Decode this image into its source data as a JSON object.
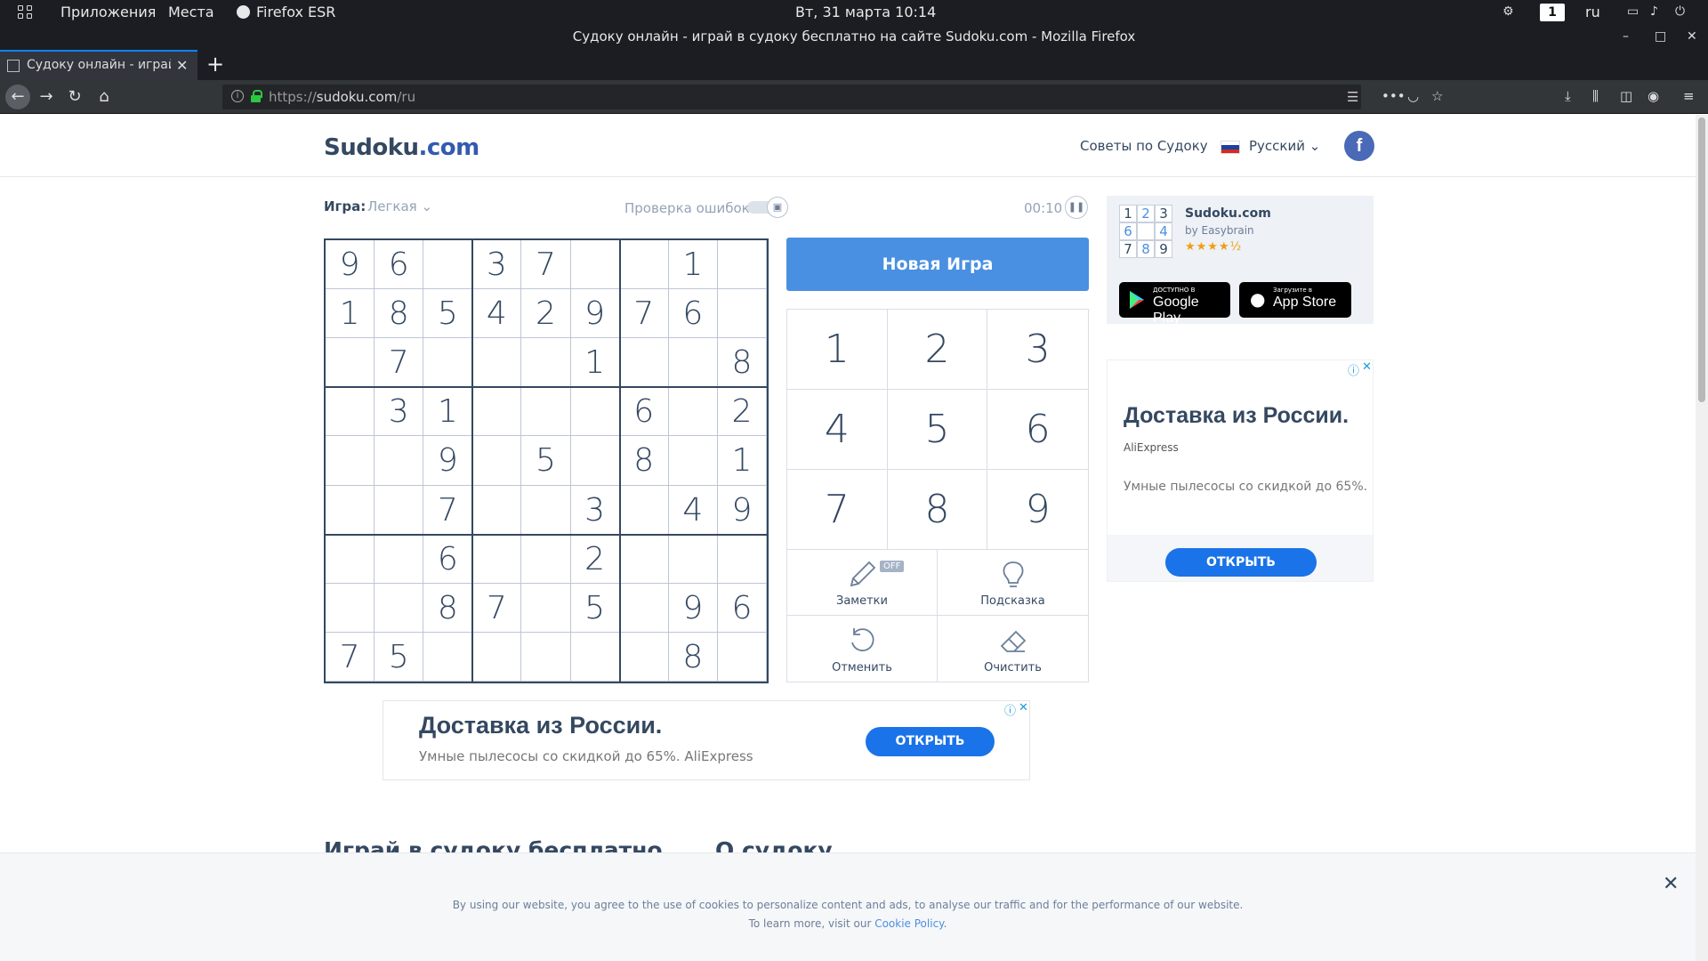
{
  "os": {
    "apps": "Приложения",
    "places": "Места",
    "browser_name": "Firefox ESR",
    "clock": "Вт, 31 марта  10:14",
    "workspace": "1",
    "lang": "ru"
  },
  "browser": {
    "window_title": "Судоку онлайн - играй в судоку бесплатно на сайте Sudoku.com - Mozilla Firefox",
    "tab_title": "Судоку онлайн - играй в судоку бесплатно",
    "url_scheme": "https://",
    "url_host": "sudoku.com",
    "url_path": "/ru"
  },
  "header": {
    "logo_main": "Sudoku",
    "logo_dot": ".com",
    "tips": "Советы по Судоку",
    "language": "Русский",
    "facebook": "f"
  },
  "game": {
    "label": "Игра:",
    "difficulty": "Легкая",
    "error_check": "Проверка ошибок",
    "timer": "00:10",
    "new_game": "Новая Игра",
    "grid": [
      [
        "9",
        "6",
        "",
        "3",
        "7",
        "",
        "",
        "1",
        ""
      ],
      [
        "1",
        "8",
        "5",
        "4",
        "2",
        "9",
        "7",
        "6",
        ""
      ],
      [
        "",
        "7",
        "",
        "",
        "",
        "1",
        "",
        "",
        "8"
      ],
      [
        "",
        "3",
        "1",
        "",
        "",
        "",
        "6",
        "",
        "2"
      ],
      [
        "",
        "",
        "9",
        "",
        "5",
        "",
        "8",
        "",
        "1"
      ],
      [
        "",
        "",
        "7",
        "",
        "",
        "3",
        "",
        "4",
        "9"
      ],
      [
        "",
        "",
        "6",
        "",
        "",
        "2",
        "",
        "",
        ""
      ],
      [
        "",
        "",
        "8",
        "7",
        "",
        "5",
        "",
        "9",
        "6"
      ],
      [
        "7",
        "5",
        "",
        "",
        "",
        "",
        "",
        "8",
        ""
      ]
    ],
    "numbers": [
      "1",
      "2",
      "3",
      "4",
      "5",
      "6",
      "7",
      "8",
      "9"
    ],
    "actions": {
      "notes": "Заметки",
      "notes_state": "OFF",
      "hint": "Подсказка",
      "undo": "Отменить",
      "erase": "Очистить"
    }
  },
  "app_card": {
    "name": "Sudoku.com",
    "by": "by Easybrain",
    "rating": 4.5,
    "grid": [
      "1",
      "2",
      "3",
      "6",
      "",
      "4",
      "7",
      "8",
      "9"
    ],
    "google_small": "ДОСТУПНО В",
    "google_big": "Google Play",
    "apple_small": "Загрузите в",
    "apple_big": "App Store"
  },
  "side_ad": {
    "headline": "Доставка из России.",
    "source": "AliExpress",
    "desc": "Умные пылесосы со скидкой до 65%.",
    "button": "ОТКРЫТЬ"
  },
  "bottom_ad": {
    "headline": "Доставка из России.",
    "desc": "Умные пылесосы со скидкой до 65%. AliExpress",
    "button": "ОТКРЫТЬ"
  },
  "sections": {
    "play_free": "Играй в судоку бесплатно",
    "about": "О судоку"
  },
  "cookie": {
    "line1": "By using our website, you agree to the use of cookies to personalize content and ads, to analyse our traffic and for the performance of our website.",
    "line2_prefix": "To learn more, visit our ",
    "line2_link": "Cookie Policy",
    "line2_suffix": "."
  },
  "colors": {
    "accent": "#4a90e2",
    "text": "#344861",
    "ad_button": "#1a73e8"
  }
}
